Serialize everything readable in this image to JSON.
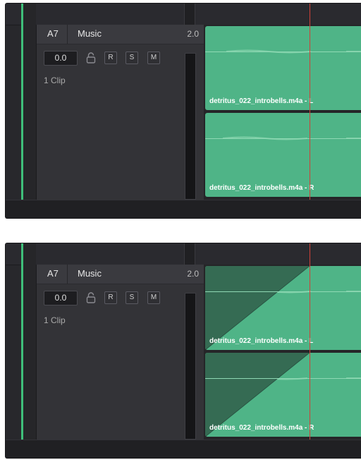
{
  "panels": [
    {
      "track": {
        "id": "A7",
        "name": "Music",
        "channels": "2.0",
        "volume": "0.0",
        "clips_label": "1 Clip"
      },
      "buttons": [
        "R",
        "S",
        "M"
      ],
      "clips": [
        {
          "label": "detritus_022_introbells.m4a - L"
        },
        {
          "label": "detritus_022_introbells.m4a - R"
        }
      ],
      "fade_in": false
    },
    {
      "track": {
        "id": "A7",
        "name": "Music",
        "channels": "2.0",
        "volume": "0.0",
        "clips_label": "1 Clip"
      },
      "buttons": [
        "R",
        "S",
        "M"
      ],
      "clips": [
        {
          "label": "detritus_022_introbells.m4a - L"
        },
        {
          "label": "detritus_022_introbells.m4a - R"
        }
      ],
      "fade_in": true
    }
  ],
  "colors": {
    "clip": "#4fb487",
    "fade": "#356b53",
    "playhead": "#d04038",
    "track_edge": "#3fbf7a"
  },
  "icons": {
    "lock": "lock-icon"
  }
}
